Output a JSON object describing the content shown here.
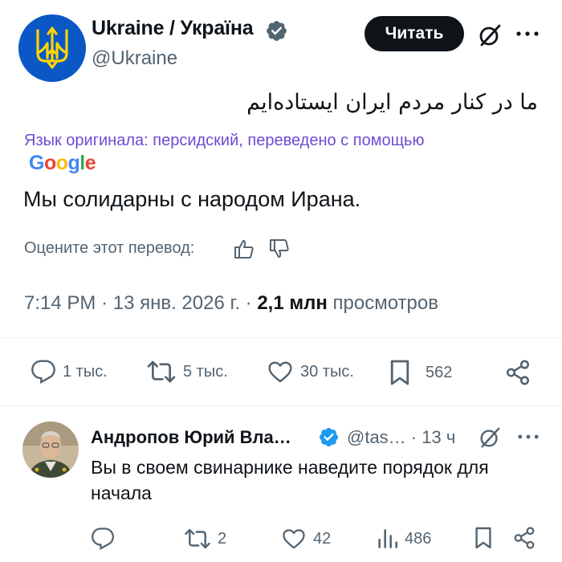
{
  "tweet": {
    "display_name": "Ukraine / Україна",
    "handle": "@Ukraine",
    "follow_label": "Читать",
    "original_text": "ما در کنار مردم ایران ایستاده‌ایم",
    "translation_note": "Язык оригинала: персидский, переведено с помощью",
    "translation_provider": "Google",
    "translated_text": "Мы солидарны с народом Ирана.",
    "rate_label": "Оцените этот перевод:",
    "time": "7:14 PM",
    "date": "13 янв. 2026 г.",
    "views_count": "2,1 млн",
    "views_label": "просмотров",
    "separator": "·",
    "actions": {
      "replies": "1 тыс.",
      "reposts": "5 тыс.",
      "likes": "30 тыс.",
      "bookmarks": "562"
    }
  },
  "reply": {
    "display_name": "Андропов Юрий Вла…",
    "handle_time": "@tas… · 13 ч",
    "text": "Вы в своем свинарнике наведите порядок для начала",
    "actions": {
      "replies": "",
      "reposts": "2",
      "likes": "42",
      "views": "486"
    }
  },
  "colors": {
    "text_primary": "#0f1419",
    "text_secondary": "#536471",
    "translation_note": "#6e4bd1",
    "verified": "#536471",
    "follow_button_bg": "#0f1419",
    "follow_button_text": "#ffffff",
    "ukraine_avatar_bg": "#0b57c6",
    "trident": "#ffd500"
  },
  "icons": {
    "verified": "verified-badge-icon",
    "grok": "grok-icon",
    "more": "more-dots-icon",
    "thumb_up": "thumbs-up-icon",
    "thumb_down": "thumbs-down-icon",
    "reply": "reply-icon",
    "repost": "repost-icon",
    "like": "heart-icon",
    "bookmark": "bookmark-icon",
    "share": "share-icon",
    "views": "views-bars-icon"
  }
}
